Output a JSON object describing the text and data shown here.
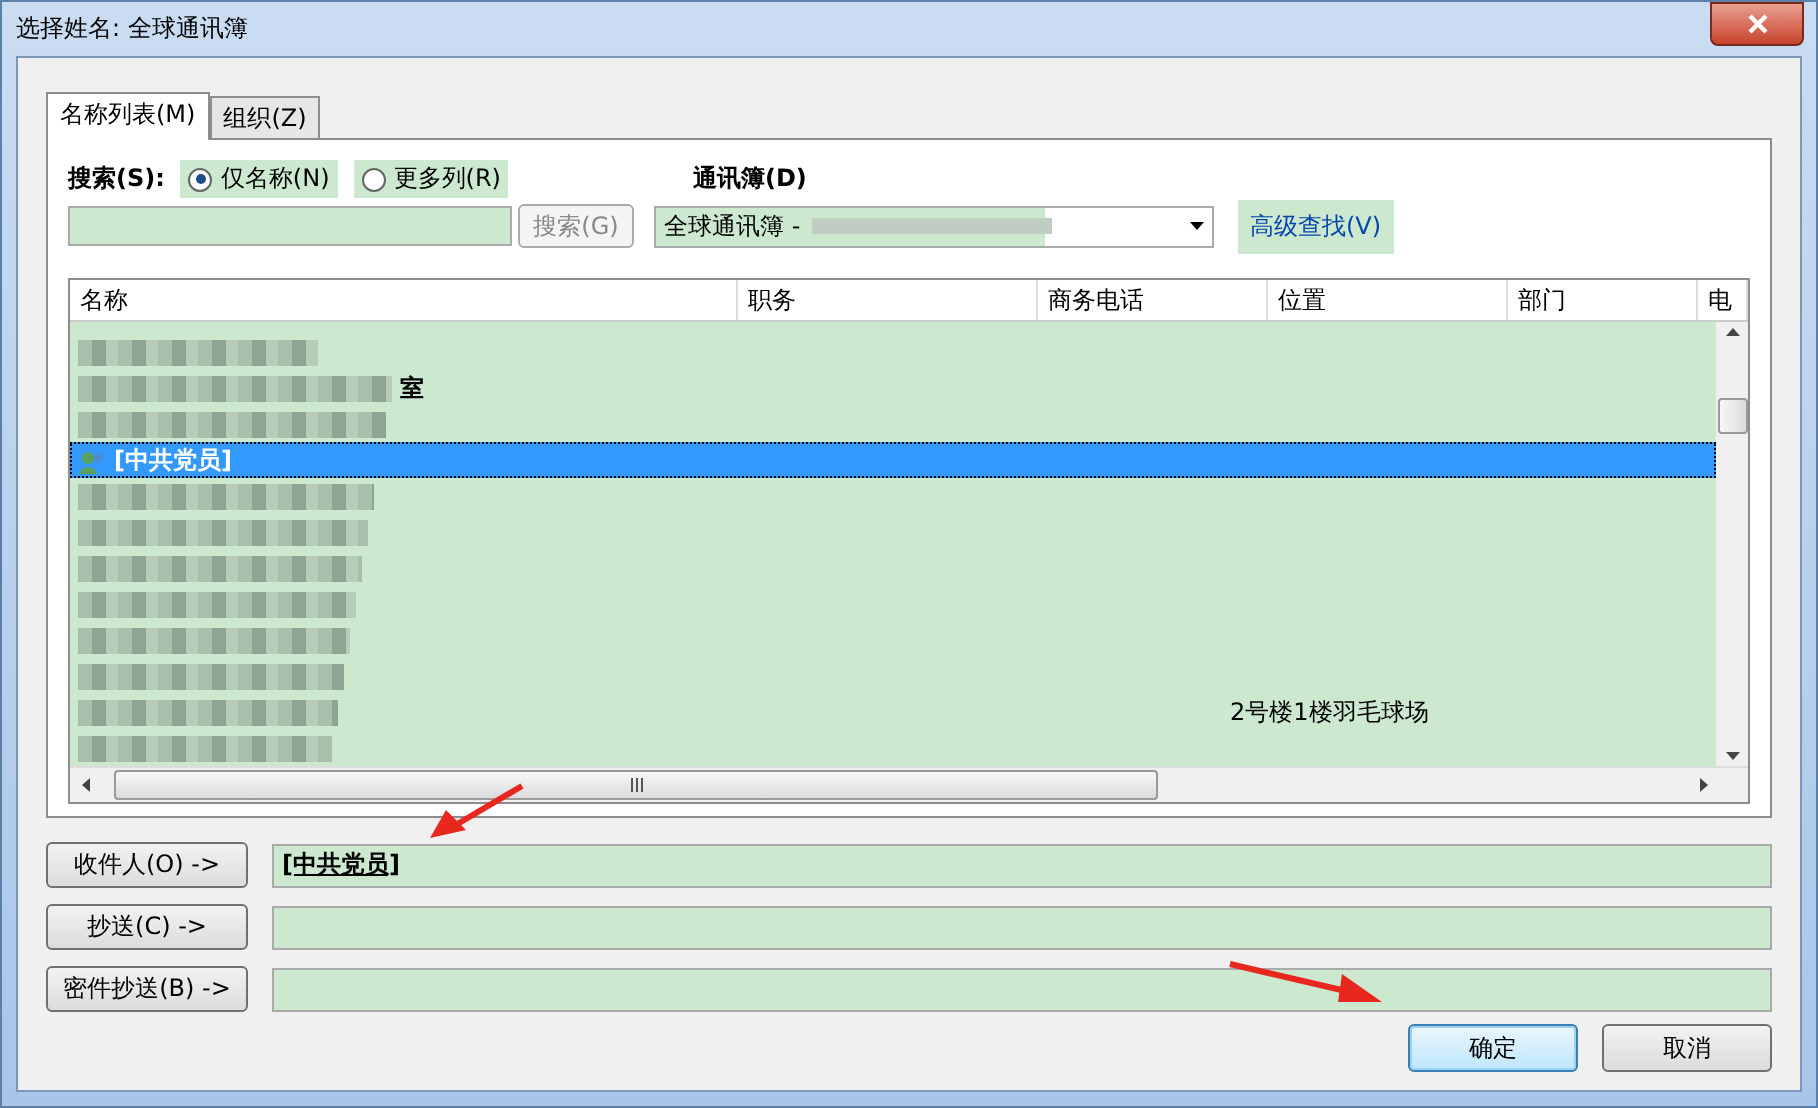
{
  "window": {
    "title": "选择姓名: 全球通讯簿"
  },
  "tabs": [
    {
      "label": "名称列表(M)",
      "selected": true
    },
    {
      "label": "组织(Z)",
      "selected": false
    }
  ],
  "search": {
    "label": "搜索(S):",
    "options": [
      {
        "label": "仅名称(N)",
        "selected": true
      },
      {
        "label": "更多列(R)",
        "selected": false
      }
    ],
    "button": {
      "label": "搜索(G)",
      "disabled": true
    }
  },
  "address_book": {
    "label": "通讯簿(D)",
    "value": "全球通讯簿 -"
  },
  "advanced_find": "高级查找(V)",
  "table": {
    "columns": [
      "名称",
      "职务",
      "商务电话",
      "位置",
      "部门",
      "电"
    ],
    "rows": [
      {
        "selected": false
      },
      {
        "selected": false,
        "name_tail": "室"
      },
      {
        "selected": false
      },
      {
        "selected": true,
        "name": "[中共党员]"
      },
      {
        "selected": false
      },
      {
        "selected": false
      },
      {
        "selected": false
      },
      {
        "selected": false
      },
      {
        "selected": false
      },
      {
        "selected": false
      },
      {
        "selected": false,
        "location": "2号楼1楼羽毛球场"
      },
      {
        "selected": false
      }
    ]
  },
  "recipients": [
    {
      "button": "收件人(O) ->",
      "value": "[中共党员]"
    },
    {
      "button": "抄送(C) ->"
    },
    {
      "button": "密件抄送(B) ->"
    }
  ],
  "buttons": [
    {
      "label": "确定",
      "default": true
    },
    {
      "label": "取消",
      "default": false
    }
  ]
}
